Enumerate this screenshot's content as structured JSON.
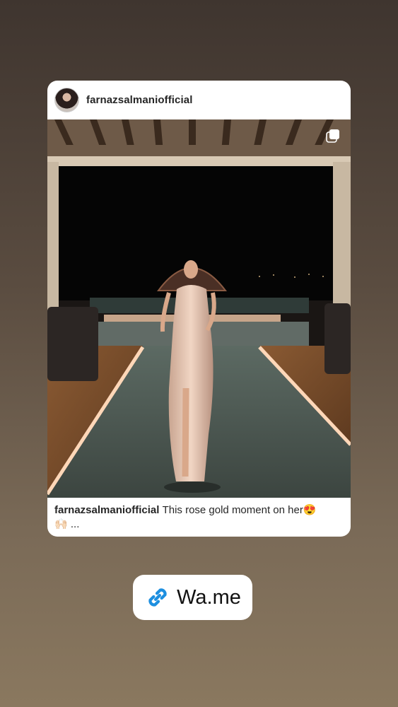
{
  "post": {
    "username": "farnazsalmaniofficial",
    "caption_user": "farnazsalmaniofficial",
    "caption_text": "This rose gold moment on her",
    "caption_emoji_1": "😍",
    "caption_emoji_2": "🙌🏻",
    "caption_more": "...",
    "avatar_icon": "profile-avatar",
    "multi_icon": "carousel-multiple-icon"
  },
  "link_sticker": {
    "label": "Wa.me",
    "icon": "link-icon",
    "accent": "#1d8fe0"
  }
}
